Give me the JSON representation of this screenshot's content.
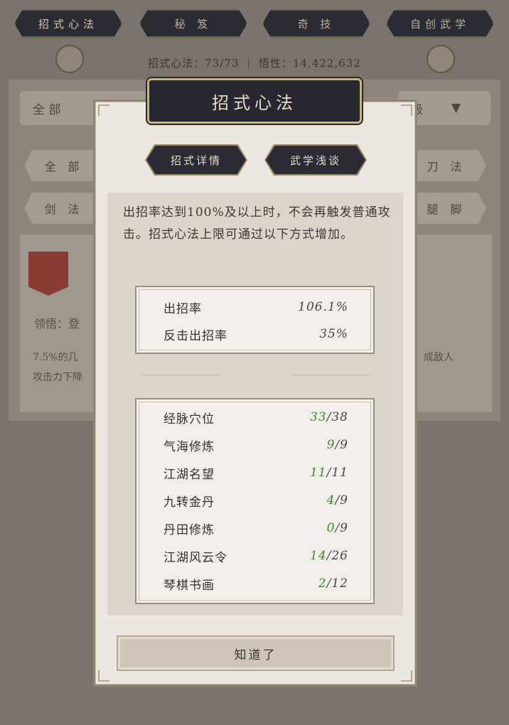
{
  "top_tabs": [
    {
      "label": "招式心法"
    },
    {
      "label": "秘 笈"
    },
    {
      "label": "奇 技"
    },
    {
      "label": "自创武学"
    }
  ],
  "stat_line": "招式心法：73/73 ｜ 悟性：14,422,632",
  "behind": {
    "filter_left": "全 部",
    "filter_right": "级",
    "pills": [
      "全 部",
      "刀 法",
      "剑 法",
      "腿 脚"
    ],
    "card_label": "领悟：登",
    "card_desc_left": "7.5%的几",
    "card_desc_left2": "攻击力下降",
    "card_desc_right": "成敌人"
  },
  "modal": {
    "title": "招式心法",
    "subtabs": [
      "招式详情",
      "武学浅谈"
    ],
    "description": "出招率达到100%及以上时，不会再触发普通攻击。招式心法上限可通过以下方式增加。",
    "rates": [
      {
        "label": "出招率",
        "value": "106.1%"
      },
      {
        "label": "反击出招率",
        "value": "35%"
      }
    ],
    "sources": [
      {
        "label": "经脉穴位",
        "current": "33",
        "max": "38"
      },
      {
        "label": "气海修炼",
        "current": "9",
        "max": "9"
      },
      {
        "label": "江湖名望",
        "current": "11",
        "max": "11"
      },
      {
        "label": "九转金丹",
        "current": "4",
        "max": "9"
      },
      {
        "label": "丹田修炼",
        "current": "0",
        "max": "9"
      },
      {
        "label": "江湖风云令",
        "current": "14",
        "max": "26"
      },
      {
        "label": "琴棋书画",
        "current": "2",
        "max": "12"
      }
    ],
    "confirm_label": "知道了"
  },
  "colors": {
    "accent_green": "#3f8a2e",
    "plate_dark": "#262730",
    "gold_border": "#c9b47e"
  }
}
